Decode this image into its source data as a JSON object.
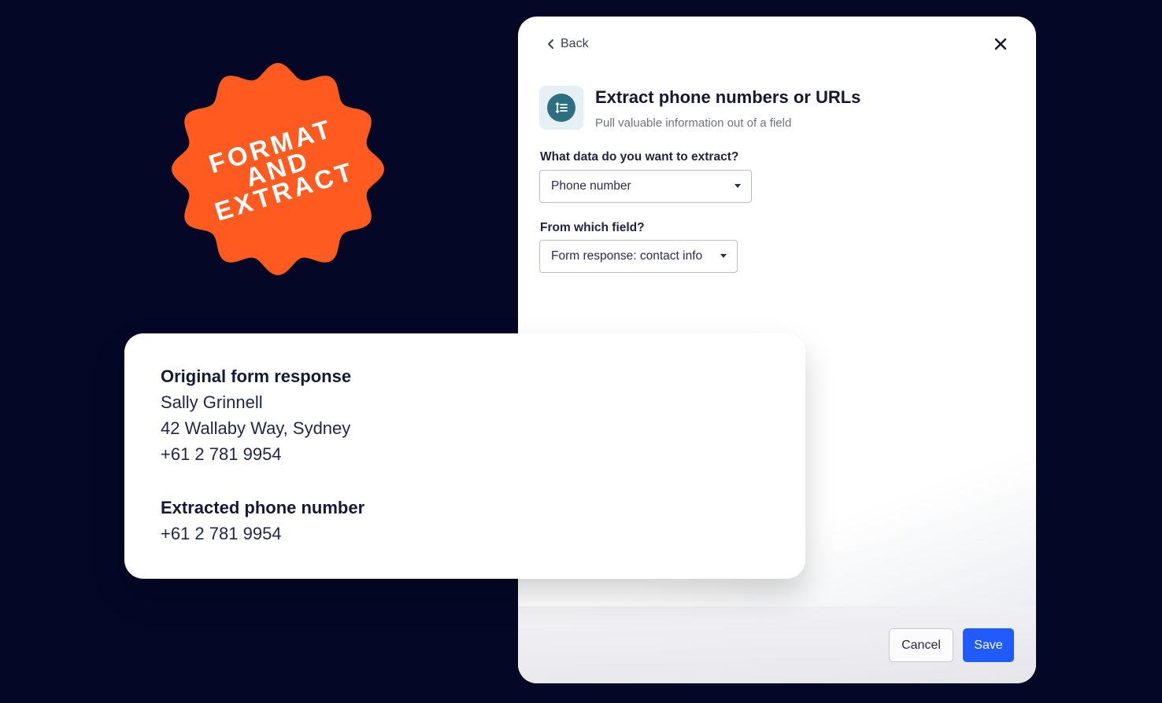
{
  "badge": {
    "lines": [
      "FORMAT",
      "AND",
      "EXTRACT"
    ],
    "color": "#ff5a1f"
  },
  "dialog": {
    "back_label": "Back",
    "close_icon": "close-icon",
    "header_icon": "list-extract-icon",
    "title": "Extract phone numbers or URLs",
    "subtitle": "Pull valuable information out of a field",
    "question1": {
      "label": "What data do you want to extract?",
      "selected": "Phone number"
    },
    "question2": {
      "label": "From which field?",
      "selected": "Form response: contact info"
    },
    "cancel_label": "Cancel",
    "save_label": "Save",
    "accent_color": "#1f5bff"
  },
  "card": {
    "original_heading": "Original form response",
    "original_lines": [
      "Sally Grinnell",
      "42 Wallaby Way, Sydney",
      "+61 2 781 9954"
    ],
    "extracted_heading": "Extracted phone number",
    "extracted_value": "+61 2 781 9954"
  }
}
